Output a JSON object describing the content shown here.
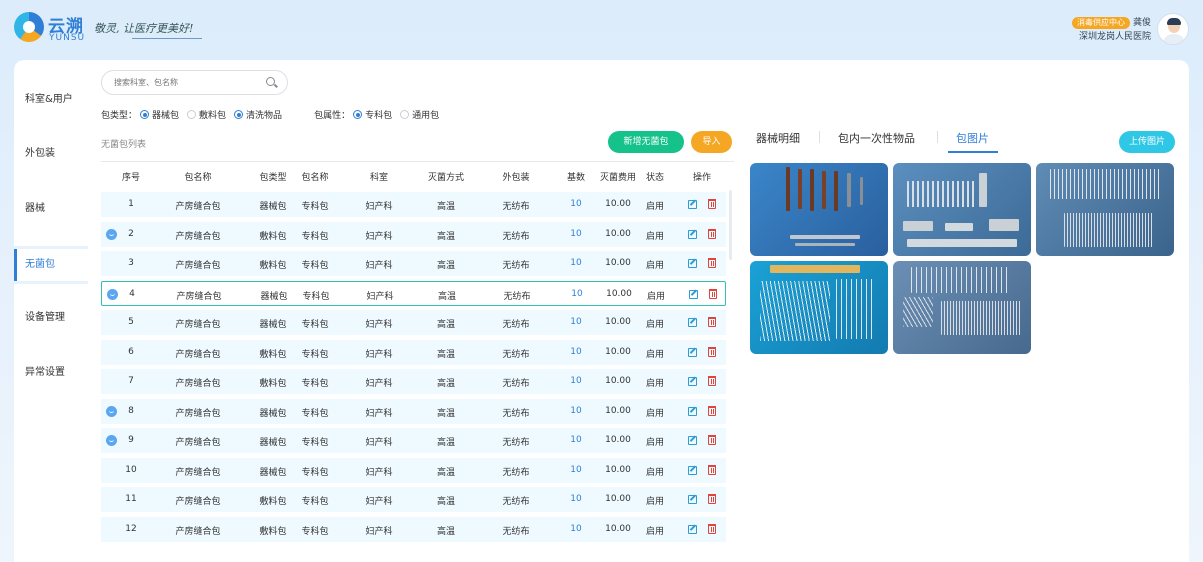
{
  "header": {
    "brand_cn": "云溯",
    "brand_en": "YUNSU",
    "slogan": "敬灵, 让医疗更美好!",
    "user_role": "消毒供应中心",
    "user_name": "龚俊",
    "hospital": "深圳龙岗人民医院"
  },
  "sidebar": {
    "items": [
      {
        "label": "科室&用户",
        "active": false
      },
      {
        "label": "外包装",
        "active": false
      },
      {
        "label": "器械",
        "active": false
      },
      {
        "label": "无菌包",
        "active": true
      },
      {
        "label": "设备管理",
        "active": false
      },
      {
        "label": "异常设置",
        "active": false
      }
    ]
  },
  "search": {
    "placeholder": "搜索科室、包名称",
    "value": ""
  },
  "filters": {
    "type_label": "包类型：",
    "type_options": [
      {
        "label": "器械包",
        "checked": true
      },
      {
        "label": "敷料包",
        "checked": false
      },
      {
        "label": "清洗物品",
        "checked": true
      }
    ],
    "attr_label": "包属性：",
    "attr_options": [
      {
        "label": "专科包",
        "checked": true
      },
      {
        "label": "通用包",
        "checked": false
      }
    ]
  },
  "list": {
    "title": "无菌包列表",
    "new_button": "新增无菌包",
    "import_button": "导入",
    "headers": [
      "序号",
      "包名称",
      "包类型",
      "包名称",
      "科室",
      "灭菌方式",
      "外包装",
      "基数",
      "灭菌费用",
      "状态",
      "操作"
    ],
    "rows": [
      {
        "no": "1",
        "name": "产房缝合包",
        "type": "器械包",
        "attr": "专科包",
        "dept": "妇产科",
        "method": "高温",
        "wrap": "无纺布",
        "base": "10",
        "fee": "10.00",
        "status": "启用",
        "msg": false,
        "selected": false
      },
      {
        "no": "2",
        "name": "产房缝合包",
        "type": "敷料包",
        "attr": "专科包",
        "dept": "妇产科",
        "method": "高温",
        "wrap": "无纺布",
        "base": "10",
        "fee": "10.00",
        "status": "启用",
        "msg": true,
        "selected": false
      },
      {
        "no": "3",
        "name": "产房缝合包",
        "type": "敷料包",
        "attr": "专科包",
        "dept": "妇产科",
        "method": "高温",
        "wrap": "无纺布",
        "base": "10",
        "fee": "10.00",
        "status": "启用",
        "msg": false,
        "selected": false
      },
      {
        "no": "4",
        "name": "产房缝合包",
        "type": "器械包",
        "attr": "专科包",
        "dept": "妇产科",
        "method": "高温",
        "wrap": "无纺布",
        "base": "10",
        "fee": "10.00",
        "status": "启用",
        "msg": true,
        "selected": true
      },
      {
        "no": "5",
        "name": "产房缝合包",
        "type": "器械包",
        "attr": "专科包",
        "dept": "妇产科",
        "method": "高温",
        "wrap": "无纺布",
        "base": "10",
        "fee": "10.00",
        "status": "启用",
        "msg": false,
        "selected": false
      },
      {
        "no": "6",
        "name": "产房缝合包",
        "type": "敷料包",
        "attr": "专科包",
        "dept": "妇产科",
        "method": "高温",
        "wrap": "无纺布",
        "base": "10",
        "fee": "10.00",
        "status": "启用",
        "msg": false,
        "selected": false
      },
      {
        "no": "7",
        "name": "产房缝合包",
        "type": "敷料包",
        "attr": "专科包",
        "dept": "妇产科",
        "method": "高温",
        "wrap": "无纺布",
        "base": "10",
        "fee": "10.00",
        "status": "启用",
        "msg": false,
        "selected": false
      },
      {
        "no": "8",
        "name": "产房缝合包",
        "type": "器械包",
        "attr": "专科包",
        "dept": "妇产科",
        "method": "高温",
        "wrap": "无纺布",
        "base": "10",
        "fee": "10.00",
        "status": "启用",
        "msg": true,
        "selected": false
      },
      {
        "no": "9",
        "name": "产房缝合包",
        "type": "器械包",
        "attr": "专科包",
        "dept": "妇产科",
        "method": "高温",
        "wrap": "无纺布",
        "base": "10",
        "fee": "10.00",
        "status": "启用",
        "msg": true,
        "selected": false
      },
      {
        "no": "10",
        "name": "产房缝合包",
        "type": "器械包",
        "attr": "专科包",
        "dept": "妇产科",
        "method": "高温",
        "wrap": "无纺布",
        "base": "10",
        "fee": "10.00",
        "status": "启用",
        "msg": false,
        "selected": false
      },
      {
        "no": "11",
        "name": "产房缝合包",
        "type": "敷料包",
        "attr": "专科包",
        "dept": "妇产科",
        "method": "高温",
        "wrap": "无纺布",
        "base": "10",
        "fee": "10.00",
        "status": "启用",
        "msg": false,
        "selected": false
      },
      {
        "no": "12",
        "name": "产房缝合包",
        "type": "敷料包",
        "attr": "专科包",
        "dept": "妇产科",
        "method": "高温",
        "wrap": "无纺布",
        "base": "10",
        "fee": "10.00",
        "status": "启用",
        "msg": false,
        "selected": false
      }
    ]
  },
  "detail": {
    "tabs": [
      {
        "label": "器械明细",
        "active": false
      },
      {
        "label": "包内一次性物品",
        "active": false
      },
      {
        "label": "包图片",
        "active": true
      }
    ],
    "upload_button": "上传图片",
    "photos": [
      "surgical-tools-photo",
      "surgical-tools-photo",
      "surgical-tools-photo",
      "surgical-tools-photo",
      "surgical-tools-photo"
    ]
  },
  "colors": {
    "primary": "#2f7fd6",
    "success": "#14c28a",
    "warning": "#f5a623",
    "accent": "#2fc7e6",
    "row_bg": "#eefaff",
    "danger": "#e0443a"
  }
}
